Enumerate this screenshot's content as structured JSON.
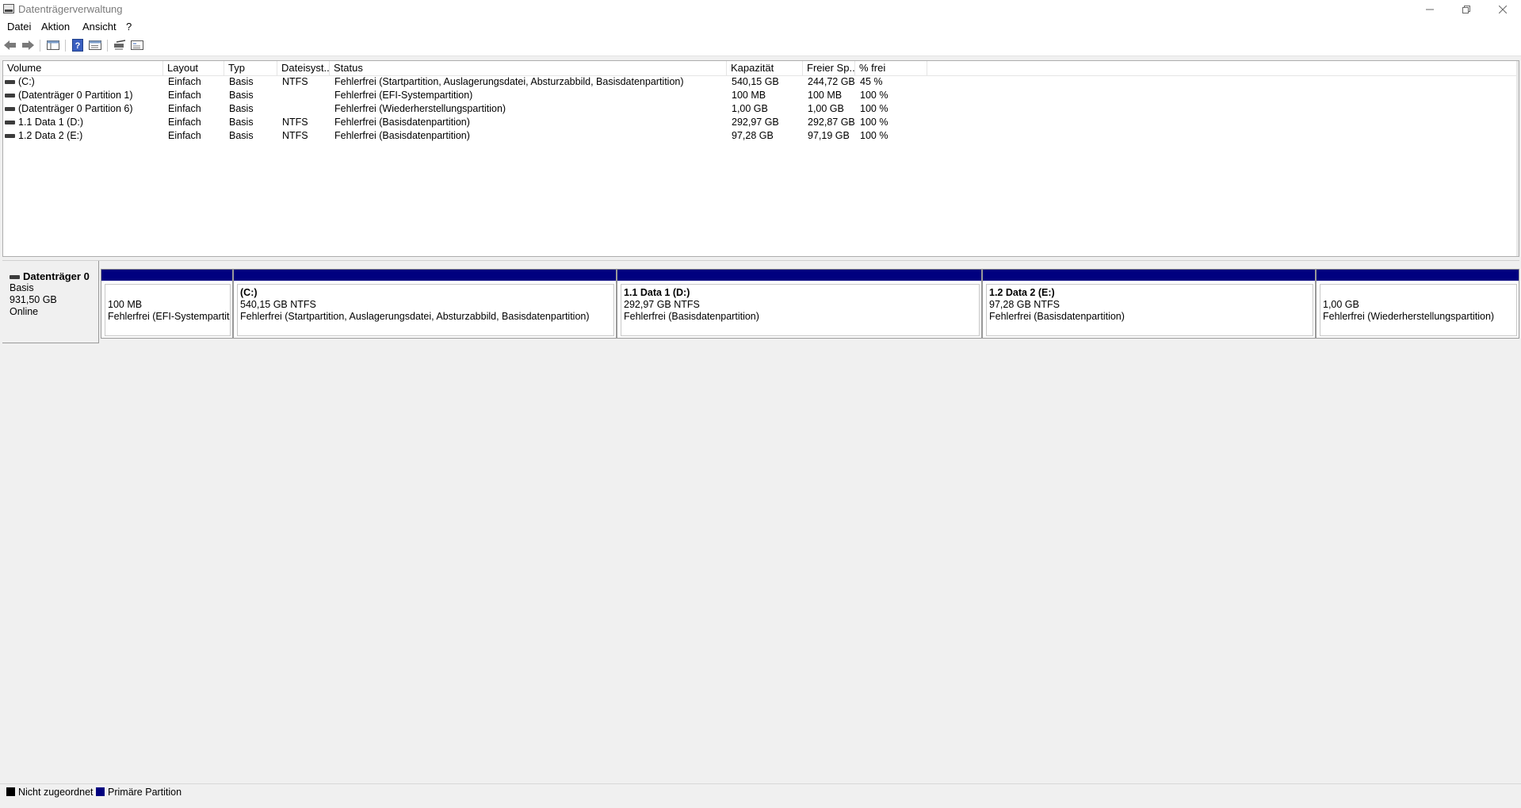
{
  "window": {
    "title": "Datenträgerverwaltung",
    "minimize_icon": "minimize-icon",
    "maximize_icon": "restore-icon",
    "close_icon": "close-icon"
  },
  "menu": {
    "items": [
      "Datei",
      "Aktion",
      "Ansicht",
      "?"
    ]
  },
  "toolbar": {
    "icons": [
      "back-arrow-icon",
      "forward-arrow-icon",
      "console-tree-icon",
      "help-icon",
      "properties-icon",
      "rescan-disks-icon",
      "settings-icon"
    ]
  },
  "volume_list": {
    "columns": [
      "Volume",
      "Layout",
      "Typ",
      "Dateisyst...",
      "Status",
      "Kapazität",
      "Freier Sp...",
      "% frei"
    ],
    "rows": [
      {
        "volume": "(C:)",
        "layout": "Einfach",
        "typ": "Basis",
        "fs": "NTFS",
        "status": "Fehlerfrei (Startpartition, Auslagerungsdatei, Absturzabbild, Basisdatenpartition)",
        "capacity": "540,15 GB",
        "free": "244,72 GB",
        "pct": "45 %"
      },
      {
        "volume": "(Datenträger 0 Partition 1)",
        "layout": "Einfach",
        "typ": "Basis",
        "fs": "",
        "status": "Fehlerfrei (EFI-Systempartition)",
        "capacity": "100 MB",
        "free": "100 MB",
        "pct": "100 %"
      },
      {
        "volume": "(Datenträger 0 Partition 6)",
        "layout": "Einfach",
        "typ": "Basis",
        "fs": "",
        "status": "Fehlerfrei (Wiederherstellungspartition)",
        "capacity": "1,00 GB",
        "free": "1,00 GB",
        "pct": "100 %"
      },
      {
        "volume": "1.1 Data 1 (D:)",
        "layout": "Einfach",
        "typ": "Basis",
        "fs": "NTFS",
        "status": "Fehlerfrei (Basisdatenpartition)",
        "capacity": "292,97 GB",
        "free": "292,87 GB",
        "pct": "100 %"
      },
      {
        "volume": "1.2 Data 2 (E:)",
        "layout": "Einfach",
        "typ": "Basis",
        "fs": "NTFS",
        "status": "Fehlerfrei (Basisdatenpartition)",
        "capacity": "97,28 GB",
        "free": "97,19 GB",
        "pct": "100 %"
      }
    ]
  },
  "disk": {
    "name": "Datenträger 0",
    "type": "Basis",
    "size": "931,50 GB",
    "state": "Online",
    "partition_color": "#00007f",
    "partitions": [
      {
        "title": "",
        "size": "100 MB",
        "status": "Fehlerfrei (EFI-Systempartitio"
      },
      {
        "title": "(C:)",
        "size": "540,15 GB NTFS",
        "status": "Fehlerfrei (Startpartition, Auslagerungsdatei, Absturzabbild, Basisdatenpartition)"
      },
      {
        "title": "1.1 Data 1  (D:)",
        "size": "292,97 GB NTFS",
        "status": "Fehlerfrei (Basisdatenpartition)"
      },
      {
        "title": "1.2 Data 2  (E:)",
        "size": "97,28 GB NTFS",
        "status": "Fehlerfrei (Basisdatenpartition)"
      },
      {
        "title": "",
        "size": "1,00 GB",
        "status": "Fehlerfrei (Wiederherstellungspartition)"
      }
    ]
  },
  "legend": {
    "unallocated_label": "Nicht zugeordnet",
    "unallocated_color": "#000000",
    "primary_label": "Primäre Partition",
    "primary_color": "#00007f"
  }
}
